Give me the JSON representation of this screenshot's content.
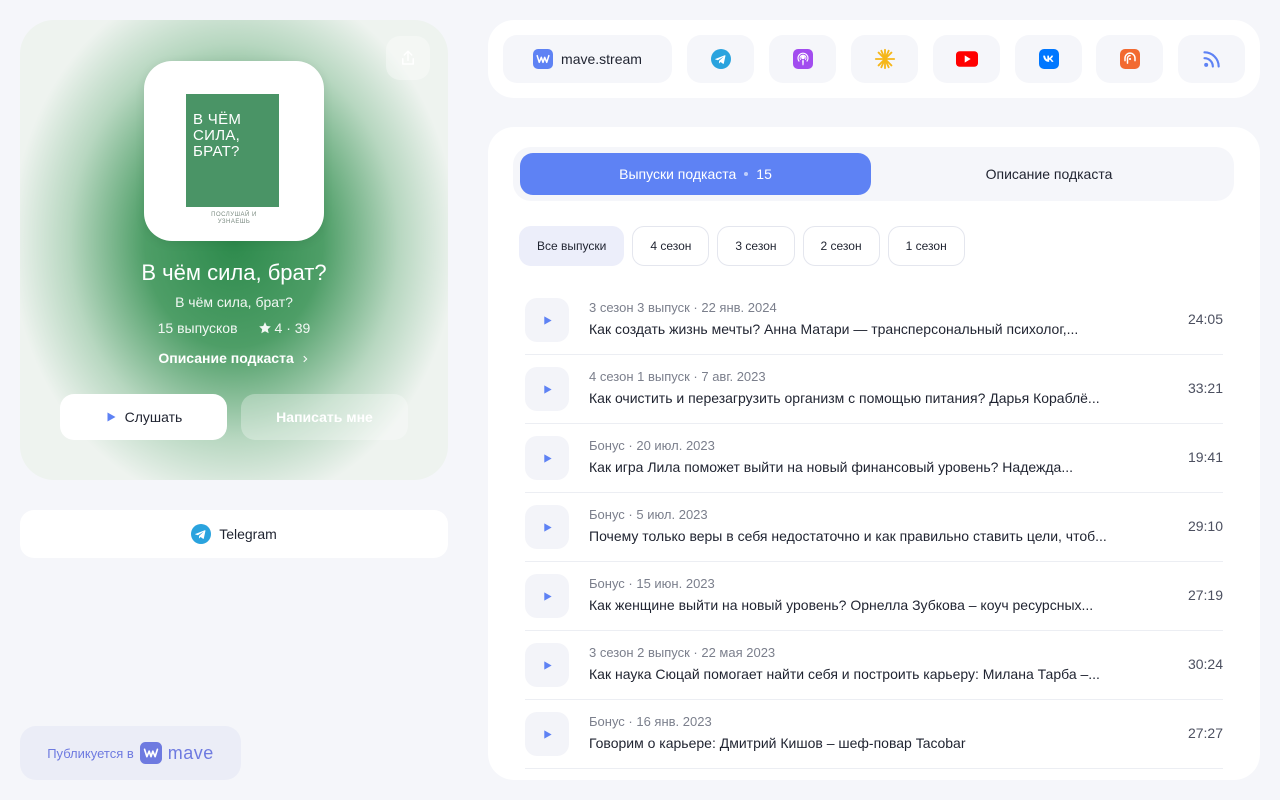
{
  "podcast": {
    "cover_lines": [
      "В ЧЁМ",
      "СИЛА,",
      "БРАТ?"
    ],
    "cover_sub": [
      "ПОСЛУШАЙ И",
      "УЗНАЕШЬ"
    ],
    "title": "В чём сила, брат?",
    "author": "В чём сила, брат?",
    "episodes_count": "15 выпусков",
    "rating": "4 · 39",
    "description_link": "Описание подкаста",
    "listen_label": "Слушать",
    "write_label": "Написать мне"
  },
  "telegram_card": {
    "label": "Telegram"
  },
  "publish_badge": {
    "prefix": "Публикуется в",
    "brand": "mave"
  },
  "platforms": {
    "mave_label": "mave.stream",
    "items": [
      {
        "name": "telegram",
        "color": "#2aa3de"
      },
      {
        "name": "apple-podcasts",
        "color": "#a24cef"
      },
      {
        "name": "yandex-music",
        "color": "#f5b619"
      },
      {
        "name": "youtube",
        "color": "#ff0000"
      },
      {
        "name": "vk",
        "color": "#0077ff"
      },
      {
        "name": "castbox",
        "color": "#f26a31"
      },
      {
        "name": "rss",
        "color": "#5e82f4"
      }
    ]
  },
  "tabs": {
    "episodes_label": "Выпуски подкаста",
    "episodes_count": "15",
    "description_label": "Описание подкаста"
  },
  "seasons": [
    "Все выпуски",
    "4 сезон",
    "3 сезон",
    "2 сезон",
    "1 сезон"
  ],
  "episodes": [
    {
      "meta": "3 сезон 3 выпуск · 22 янв. 2024",
      "title": "Как создать жизнь мечты? Анна Матари — трансперсональный психолог,...",
      "duration": "24:05"
    },
    {
      "meta": "4 сезон 1 выпуск · 7 авг. 2023",
      "title": "Как очистить и перезагрузить организм с помощью питания? Дарья Кораблё...",
      "duration": "33:21"
    },
    {
      "meta": "Бонус · 20 июл. 2023",
      "title": "Как игра Лила поможет выйти на новый финансовый уровень? Надежда...",
      "duration": "19:41"
    },
    {
      "meta": "Бонус · 5 июл. 2023",
      "title": "Почему только веры в себя недостаточно и как правильно ставить цели, чтоб...",
      "duration": "29:10"
    },
    {
      "meta": "Бонус · 15 июн. 2023",
      "title": "Как женщине выйти на новый уровень? Орнелла Зубкова – коуч ресурсных...",
      "duration": "27:19"
    },
    {
      "meta": "3 сезон 2 выпуск · 22 мая 2023",
      "title": "Как наука Сюцай помогает найти себя и построить карьеру: Милана Тарба –...",
      "duration": "30:24"
    },
    {
      "meta": "Бонус · 16 янв. 2023",
      "title": "Говорим о карьере: Дмитрий Кишов – шеф-повар Tacobar",
      "duration": "27:27"
    }
  ],
  "colors": {
    "accent": "#5e82f4",
    "cover_green": "#4a9466"
  }
}
